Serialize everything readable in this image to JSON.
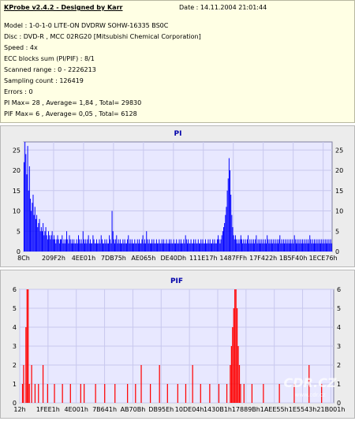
{
  "header": {
    "title": "KProbe v2.4.2 - Designed by Karr",
    "date": "Date : 14.11.2004 21:01:44",
    "lines": [
      "Model : 1-0-1-0 LITE-ON DVDRW SOHW-16335 BS0C",
      "Disc : DVD-R , MCC 02RG20  [Mitsubishi Chemical Corporation]",
      "Speed : 4x",
      "ECC blocks sum (PI/PIF) : 8/1",
      "Scanned range : 0 - 2226213",
      "Sampling count : 126419",
      "Errors : 0",
      "PI Max= 28 , Average= 1,84 , Total= 29830",
      "PIF Max= 6 , Average= 0,05 , Total= 6128"
    ]
  },
  "watermark": "CDR.CZ",
  "watermark_url": "www.cdr.cz",
  "chart_data": [
    {
      "type": "bar",
      "title": "PI",
      "ylim": [
        0,
        27
      ],
      "yticks": [
        0,
        5,
        10,
        15,
        20,
        25
      ],
      "xtick_labels": [
        "8Ch",
        "209F2h",
        "4EE01h",
        "7DB75h",
        "AE065h",
        "DE40Dh",
        "111E17h",
        "1487FFh",
        "17F422h",
        "1B5F40h",
        "1ECE76h"
      ],
      "bar_color": "#0000ff",
      "grid": true,
      "values": [
        22,
        27,
        24,
        19,
        26,
        15,
        21,
        13,
        10,
        12,
        14,
        9,
        11,
        8,
        9,
        6,
        7,
        8,
        5,
        6,
        5,
        7,
        4,
        5,
        6,
        4,
        3,
        5,
        4,
        3,
        4,
        5,
        3,
        4,
        3,
        2,
        3,
        4,
        3,
        2,
        3,
        3,
        4,
        2,
        3,
        2,
        3,
        5,
        3,
        2,
        4,
        3,
        2,
        3,
        2,
        3,
        2,
        2,
        3,
        2,
        4,
        3,
        2,
        3,
        2,
        5,
        3,
        2,
        3,
        2,
        3,
        4,
        2,
        3,
        2,
        2,
        4,
        3,
        2,
        2,
        3,
        2,
        2,
        3,
        2,
        4,
        3,
        2,
        2,
        3,
        2,
        3,
        2,
        2,
        4,
        3,
        2,
        10,
        5,
        3,
        2,
        3,
        4,
        2,
        3,
        2,
        3,
        2,
        2,
        3,
        2,
        3,
        2,
        2,
        3,
        4,
        2,
        3,
        2,
        3,
        2,
        2,
        3,
        2,
        2,
        3,
        2,
        3,
        2,
        2,
        3,
        4,
        2,
        3,
        2,
        5,
        3,
        2,
        3,
        2,
        2,
        3,
        2,
        3,
        2,
        2,
        3,
        2,
        2,
        3,
        2,
        2,
        3,
        2,
        3,
        2,
        2,
        3,
        2,
        2,
        3,
        2,
        3,
        2,
        2,
        3,
        2,
        2,
        3,
        2,
        2,
        3,
        2,
        3,
        2,
        2,
        3,
        2,
        4,
        3,
        2,
        3,
        2,
        2,
        3,
        2,
        2,
        3,
        2,
        3,
        2,
        2,
        3,
        2,
        2,
        3,
        2,
        3,
        2,
        2,
        3,
        2,
        2,
        3,
        2,
        3,
        2,
        2,
        3,
        2,
        3,
        2,
        2,
        3,
        4,
        3,
        2,
        3,
        4,
        5,
        6,
        7,
        9,
        11,
        15,
        18,
        23,
        20,
        14,
        9,
        6,
        4,
        3,
        4,
        3,
        2,
        3,
        2,
        3,
        4,
        3,
        2,
        3,
        2,
        3,
        2,
        3,
        4,
        2,
        3,
        2,
        3,
        2,
        3,
        2,
        3,
        4,
        2,
        3,
        2,
        3,
        2,
        3,
        2,
        3,
        2,
        3,
        2,
        4,
        3,
        2,
        3,
        2,
        3,
        2,
        3,
        2,
        3,
        2,
        3,
        2,
        3,
        4,
        2,
        3,
        2,
        3,
        2,
        3,
        2,
        3,
        2,
        3,
        2,
        3,
        2,
        3,
        2,
        4,
        3,
        2,
        3,
        2,
        3,
        2,
        3,
        2,
        3,
        2,
        3,
        2,
        3,
        2,
        3,
        2,
        4,
        3,
        2,
        3,
        2,
        3,
        2,
        3,
        2,
        3,
        2,
        3,
        2,
        3,
        2,
        3,
        2,
        3,
        2,
        3,
        2,
        3,
        2,
        3,
        2
      ]
    },
    {
      "type": "bar",
      "title": "PIF",
      "ylim": [
        0,
        6
      ],
      "yticks": [
        0,
        1,
        2,
        3,
        4,
        5,
        6
      ],
      "xtick_labels": [
        "12h",
        "1FEE1h",
        "4E001h",
        "7B641h",
        "AB70Bh",
        "DB95Eh",
        "10DE04h",
        "1430B1h",
        "17889Bh",
        "1AEE55h",
        "1E5543h",
        "21B001h"
      ],
      "bar_color": "#ff0000",
      "grid": true,
      "values": [
        0,
        0,
        1,
        2,
        0,
        4,
        6,
        6,
        1,
        0,
        2,
        0,
        0,
        1,
        0,
        0,
        1,
        0,
        0,
        0,
        2,
        0,
        0,
        0,
        1,
        0,
        0,
        0,
        0,
        0,
        1,
        0,
        0,
        0,
        0,
        0,
        0,
        1,
        0,
        0,
        0,
        0,
        0,
        0,
        1,
        0,
        0,
        0,
        0,
        0,
        0,
        0,
        0,
        1,
        0,
        0,
        1,
        0,
        0,
        0,
        0,
        0,
        0,
        0,
        0,
        0,
        1,
        0,
        0,
        0,
        0,
        0,
        0,
        0,
        1,
        0,
        0,
        0,
        0,
        0,
        0,
        0,
        0,
        1,
        0,
        0,
        0,
        0,
        0,
        0,
        0,
        0,
        0,
        0,
        1,
        0,
        0,
        0,
        0,
        0,
        0,
        1,
        0,
        0,
        0,
        0,
        2,
        0,
        0,
        0,
        0,
        0,
        0,
        0,
        1,
        0,
        0,
        0,
        0,
        0,
        0,
        0,
        2,
        0,
        0,
        0,
        0,
        0,
        0,
        1,
        0,
        0,
        0,
        0,
        0,
        0,
        0,
        0,
        1,
        0,
        0,
        0,
        0,
        0,
        0,
        1,
        0,
        0,
        0,
        0,
        0,
        2,
        0,
        0,
        0,
        0,
        0,
        0,
        1,
        0,
        0,
        0,
        0,
        0,
        0,
        0,
        1,
        0,
        0,
        0,
        0,
        0,
        0,
        0,
        1,
        0,
        0,
        0,
        0,
        0,
        0,
        1,
        0,
        0,
        2,
        3,
        4,
        5,
        6,
        6,
        5,
        3,
        2,
        1,
        0,
        0,
        1,
        0,
        0,
        0,
        0,
        0,
        0,
        1,
        0,
        0,
        0,
        0,
        0,
        0,
        0,
        0,
        0,
        1,
        0,
        0,
        0,
        0,
        0,
        0,
        0,
        0,
        0,
        0,
        0,
        0,
        0,
        1,
        0,
        0,
        0,
        0,
        0,
        0,
        0,
        0,
        0,
        0,
        0,
        0,
        1,
        0,
        0,
        0,
        0,
        0,
        0,
        0,
        0,
        0,
        0,
        0,
        0,
        2,
        0,
        0,
        0,
        0,
        0,
        0,
        0,
        0,
        0,
        0,
        1,
        0,
        0,
        0,
        0,
        0,
        0,
        0,
        0,
        0,
        0
      ]
    }
  ]
}
